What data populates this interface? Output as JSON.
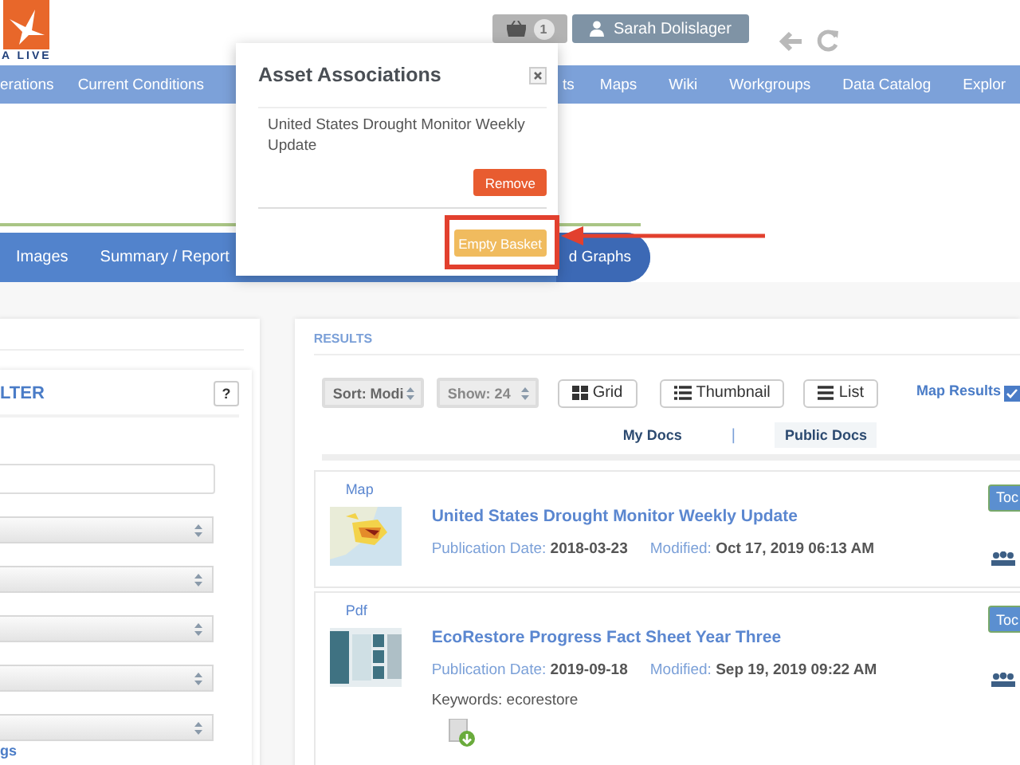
{
  "header": {
    "logo_text": "A LIVE",
    "basket_count": "1",
    "user": "Sarah Dolislager"
  },
  "nav": [
    "erations",
    "Current Conditions",
    "ts",
    "Maps",
    "Wiki",
    "Workgroups",
    "Data Catalog",
    "Explor"
  ],
  "tabs": [
    {
      "label": "Images",
      "selected": false
    },
    {
      "label": "Summary / Report",
      "selected": false
    },
    {
      "label": "d Graphs",
      "selected": true
    }
  ],
  "filter": {
    "title": "LTER",
    "help": "?",
    "fields": [
      {
        "kind": "text"
      },
      {
        "kind": "select"
      },
      {
        "kind": "select"
      },
      {
        "kind": "select"
      },
      {
        "kind": "select"
      },
      {
        "kind": "select"
      }
    ],
    "link": "gs"
  },
  "results": {
    "title": "RESULTS",
    "sort": "Sort: Modi",
    "show": "Show: 24",
    "views": [
      "Grid",
      "Thumbnail",
      "List"
    ],
    "map_results": {
      "label": "Map Results",
      "checked": true
    },
    "doc_tabs": [
      {
        "label": "My Docs",
        "selected": false
      },
      {
        "label": "Public Docs",
        "selected": true
      }
    ],
    "separator": "|",
    "items": [
      {
        "type": "Map",
        "title": "United States Drought Monitor Weekly Update",
        "published": "Publication Date: **2018-03-23**",
        "modified": "Modified: **Oct 17, 2019 06:13 AM**",
        "button": "Toc"
      },
      {
        "type": "Pdf",
        "title": "EcoRestore Progress Fact Sheet Year Three",
        "published": "Publication Date: **2019-09-18**",
        "modified": "Modified: **Sep 19, 2019 09:22 AM**",
        "keywords": "Keywords: ecorestore",
        "download": true,
        "button": "Toc"
      }
    ]
  },
  "modal": {
    "title": "Asset Associations",
    "item": "United States Drought Monitor Weekly Update",
    "remove": "Remove",
    "empty": "Empty Basket",
    "highlighted": true
  }
}
